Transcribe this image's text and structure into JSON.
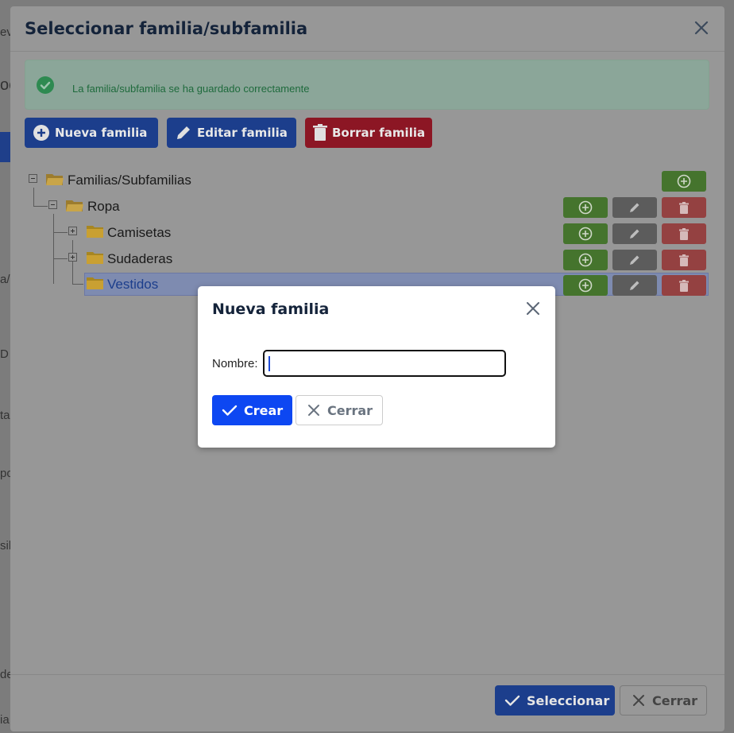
{
  "background": {
    "fragments": [
      "ev",
      "oc",
      "a/",
      "D",
      "ta",
      "po",
      "sib",
      "de",
      "ia"
    ]
  },
  "modal": {
    "title": "Seleccionar familia/subfamilia",
    "alert_text": "La familia/subfamilia se ha guardado correctamente",
    "toolbar": {
      "new_family": "Nueva familia",
      "edit_family": "Editar familia",
      "delete_family": "Borrar familia"
    },
    "tree": {
      "root": "Familias/Subfamilias",
      "items": [
        {
          "label": "Ropa"
        },
        {
          "label": "Camisetas"
        },
        {
          "label": "Sudaderas"
        },
        {
          "label": "Vestidos"
        }
      ]
    },
    "footer": {
      "select_label": "Seleccionar",
      "close_label": "Cerrar"
    }
  },
  "dialog": {
    "title": "Nueva familia",
    "name_label": "Nombre:",
    "name_value": "",
    "create_label": "Crear",
    "close_label": "Cerrar"
  },
  "colors": {
    "primary": "#0d47f2",
    "success": "#45742d",
    "danger": "#944141",
    "overlay_dim": "#979797"
  }
}
